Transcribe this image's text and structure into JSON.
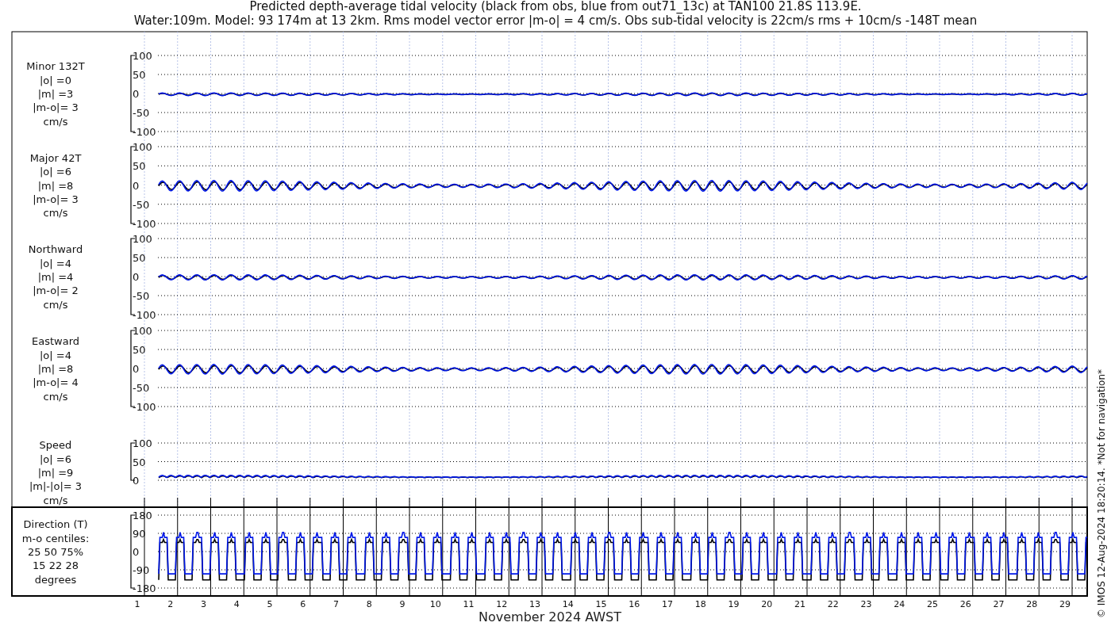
{
  "title_lines": [
    "Predicted depth-average tidal velocity (black from obs, blue from out71_13c) at TAN100 21.8S 113.9E.",
    "Water:109m. Model: 93 174m at 13 2km. Rms model vector error |m-o| = 4 cm/s. Obs sub-tidal velocity is 22cm/s rms + 10cm/s -148T mean"
  ],
  "panels": [
    {
      "kind": "velocity",
      "label_lines": [
        "Minor 132T",
        "|o| =0",
        "|m| =3",
        "|m-o|= 3",
        "cm/s"
      ],
      "yticks": [
        "100",
        "50",
        "0",
        "-50",
        "-100"
      ]
    },
    {
      "kind": "velocity",
      "label_lines": [
        "Major 42T",
        "|o| =6",
        "|m| =8",
        "|m-o|= 3",
        "cm/s"
      ],
      "yticks": [
        "100",
        "50",
        "0",
        "-50",
        "-100"
      ]
    },
    {
      "kind": "velocity",
      "label_lines": [
        "Northward",
        "|o| =4",
        "|m| =4",
        "|m-o|= 2",
        "cm/s"
      ],
      "yticks": [
        "100",
        "50",
        "0",
        "-50",
        "-100"
      ]
    },
    {
      "kind": "velocity",
      "label_lines": [
        "Eastward",
        "|o| =4",
        "|m| =8",
        "|m-o|= 4",
        "cm/s"
      ],
      "yticks": [
        "100",
        "50",
        "0",
        "-50",
        "-100"
      ]
    },
    {
      "kind": "speed",
      "label_lines": [
        "Speed",
        "|o| =6",
        "|m| =9",
        "|m|-|o|= 3",
        "cm/s"
      ],
      "yticks": [
        "100",
        "50",
        "0"
      ]
    },
    {
      "kind": "direction",
      "label_lines": [
        "Direction (T)",
        "m-o centiles:",
        "25  50  75%",
        "15  22  28",
        "degrees"
      ],
      "yticks": [
        "180",
        "90",
        "0",
        "-90",
        "-180"
      ]
    }
  ],
  "day_labels": [
    "1",
    "2",
    "3",
    "4",
    "5",
    "6",
    "7",
    "8",
    "9",
    "10",
    "11",
    "12",
    "13",
    "14",
    "15",
    "16",
    "17",
    "18",
    "19",
    "20",
    "21",
    "22",
    "23",
    "24",
    "25",
    "26",
    "27",
    "28",
    "29"
  ],
  "xlabel": "November 2024 AWST",
  "credit": "© IMOS 12-Aug-2024 18:20:14. *Not for navigation*"
}
